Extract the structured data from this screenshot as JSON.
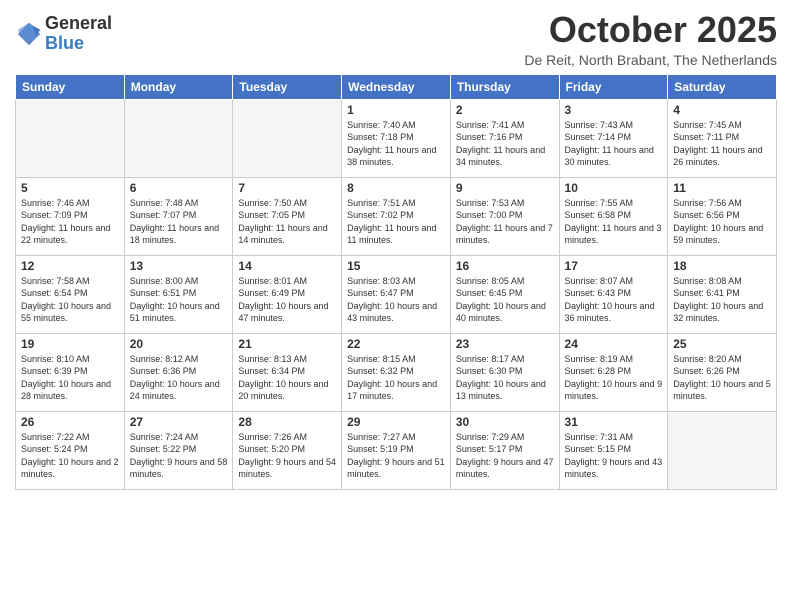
{
  "header": {
    "logo_line1": "General",
    "logo_line2": "Blue",
    "month": "October 2025",
    "location": "De Reit, North Brabant, The Netherlands"
  },
  "weekdays": [
    "Sunday",
    "Monday",
    "Tuesday",
    "Wednesday",
    "Thursday",
    "Friday",
    "Saturday"
  ],
  "weeks": [
    [
      {
        "day": "",
        "sunrise": "",
        "sunset": "",
        "daylight": ""
      },
      {
        "day": "",
        "sunrise": "",
        "sunset": "",
        "daylight": ""
      },
      {
        "day": "",
        "sunrise": "",
        "sunset": "",
        "daylight": ""
      },
      {
        "day": "1",
        "sunrise": "Sunrise: 7:40 AM",
        "sunset": "Sunset: 7:18 PM",
        "daylight": "Daylight: 11 hours and 38 minutes."
      },
      {
        "day": "2",
        "sunrise": "Sunrise: 7:41 AM",
        "sunset": "Sunset: 7:16 PM",
        "daylight": "Daylight: 11 hours and 34 minutes."
      },
      {
        "day": "3",
        "sunrise": "Sunrise: 7:43 AM",
        "sunset": "Sunset: 7:14 PM",
        "daylight": "Daylight: 11 hours and 30 minutes."
      },
      {
        "day": "4",
        "sunrise": "Sunrise: 7:45 AM",
        "sunset": "Sunset: 7:11 PM",
        "daylight": "Daylight: 11 hours and 26 minutes."
      }
    ],
    [
      {
        "day": "5",
        "sunrise": "Sunrise: 7:46 AM",
        "sunset": "Sunset: 7:09 PM",
        "daylight": "Daylight: 11 hours and 22 minutes."
      },
      {
        "day": "6",
        "sunrise": "Sunrise: 7:48 AM",
        "sunset": "Sunset: 7:07 PM",
        "daylight": "Daylight: 11 hours and 18 minutes."
      },
      {
        "day": "7",
        "sunrise": "Sunrise: 7:50 AM",
        "sunset": "Sunset: 7:05 PM",
        "daylight": "Daylight: 11 hours and 14 minutes."
      },
      {
        "day": "8",
        "sunrise": "Sunrise: 7:51 AM",
        "sunset": "Sunset: 7:02 PM",
        "daylight": "Daylight: 11 hours and 11 minutes."
      },
      {
        "day": "9",
        "sunrise": "Sunrise: 7:53 AM",
        "sunset": "Sunset: 7:00 PM",
        "daylight": "Daylight: 11 hours and 7 minutes."
      },
      {
        "day": "10",
        "sunrise": "Sunrise: 7:55 AM",
        "sunset": "Sunset: 6:58 PM",
        "daylight": "Daylight: 11 hours and 3 minutes."
      },
      {
        "day": "11",
        "sunrise": "Sunrise: 7:56 AM",
        "sunset": "Sunset: 6:56 PM",
        "daylight": "Daylight: 10 hours and 59 minutes."
      }
    ],
    [
      {
        "day": "12",
        "sunrise": "Sunrise: 7:58 AM",
        "sunset": "Sunset: 6:54 PM",
        "daylight": "Daylight: 10 hours and 55 minutes."
      },
      {
        "day": "13",
        "sunrise": "Sunrise: 8:00 AM",
        "sunset": "Sunset: 6:51 PM",
        "daylight": "Daylight: 10 hours and 51 minutes."
      },
      {
        "day": "14",
        "sunrise": "Sunrise: 8:01 AM",
        "sunset": "Sunset: 6:49 PM",
        "daylight": "Daylight: 10 hours and 47 minutes."
      },
      {
        "day": "15",
        "sunrise": "Sunrise: 8:03 AM",
        "sunset": "Sunset: 6:47 PM",
        "daylight": "Daylight: 10 hours and 43 minutes."
      },
      {
        "day": "16",
        "sunrise": "Sunrise: 8:05 AM",
        "sunset": "Sunset: 6:45 PM",
        "daylight": "Daylight: 10 hours and 40 minutes."
      },
      {
        "day": "17",
        "sunrise": "Sunrise: 8:07 AM",
        "sunset": "Sunset: 6:43 PM",
        "daylight": "Daylight: 10 hours and 36 minutes."
      },
      {
        "day": "18",
        "sunrise": "Sunrise: 8:08 AM",
        "sunset": "Sunset: 6:41 PM",
        "daylight": "Daylight: 10 hours and 32 minutes."
      }
    ],
    [
      {
        "day": "19",
        "sunrise": "Sunrise: 8:10 AM",
        "sunset": "Sunset: 6:39 PM",
        "daylight": "Daylight: 10 hours and 28 minutes."
      },
      {
        "day": "20",
        "sunrise": "Sunrise: 8:12 AM",
        "sunset": "Sunset: 6:36 PM",
        "daylight": "Daylight: 10 hours and 24 minutes."
      },
      {
        "day": "21",
        "sunrise": "Sunrise: 8:13 AM",
        "sunset": "Sunset: 6:34 PM",
        "daylight": "Daylight: 10 hours and 20 minutes."
      },
      {
        "day": "22",
        "sunrise": "Sunrise: 8:15 AM",
        "sunset": "Sunset: 6:32 PM",
        "daylight": "Daylight: 10 hours and 17 minutes."
      },
      {
        "day": "23",
        "sunrise": "Sunrise: 8:17 AM",
        "sunset": "Sunset: 6:30 PM",
        "daylight": "Daylight: 10 hours and 13 minutes."
      },
      {
        "day": "24",
        "sunrise": "Sunrise: 8:19 AM",
        "sunset": "Sunset: 6:28 PM",
        "daylight": "Daylight: 10 hours and 9 minutes."
      },
      {
        "day": "25",
        "sunrise": "Sunrise: 8:20 AM",
        "sunset": "Sunset: 6:26 PM",
        "daylight": "Daylight: 10 hours and 5 minutes."
      }
    ],
    [
      {
        "day": "26",
        "sunrise": "Sunrise: 7:22 AM",
        "sunset": "Sunset: 5:24 PM",
        "daylight": "Daylight: 10 hours and 2 minutes."
      },
      {
        "day": "27",
        "sunrise": "Sunrise: 7:24 AM",
        "sunset": "Sunset: 5:22 PM",
        "daylight": "Daylight: 9 hours and 58 minutes."
      },
      {
        "day": "28",
        "sunrise": "Sunrise: 7:26 AM",
        "sunset": "Sunset: 5:20 PM",
        "daylight": "Daylight: 9 hours and 54 minutes."
      },
      {
        "day": "29",
        "sunrise": "Sunrise: 7:27 AM",
        "sunset": "Sunset: 5:19 PM",
        "daylight": "Daylight: 9 hours and 51 minutes."
      },
      {
        "day": "30",
        "sunrise": "Sunrise: 7:29 AM",
        "sunset": "Sunset: 5:17 PM",
        "daylight": "Daylight: 9 hours and 47 minutes."
      },
      {
        "day": "31",
        "sunrise": "Sunrise: 7:31 AM",
        "sunset": "Sunset: 5:15 PM",
        "daylight": "Daylight: 9 hours and 43 minutes."
      },
      {
        "day": "",
        "sunrise": "",
        "sunset": "",
        "daylight": ""
      }
    ]
  ]
}
